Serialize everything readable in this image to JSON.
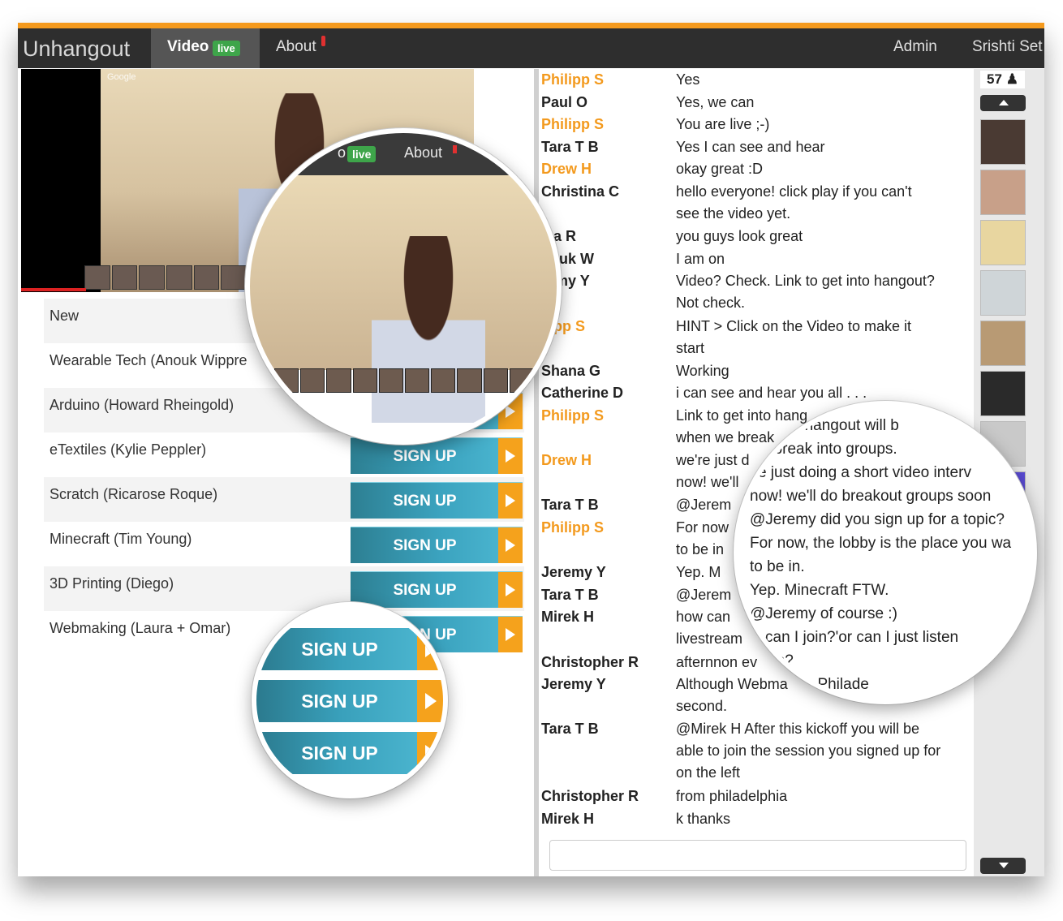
{
  "navbar": {
    "brand": "Unhangout",
    "video_tab": "Video",
    "live_badge": "live",
    "about_tab": "About",
    "admin": "Admin",
    "user": "Srishti Set"
  },
  "video": {
    "watermark": "Google"
  },
  "sessions": [
    {
      "name": "New",
      "has_signup": false
    },
    {
      "name": "Wearable Tech (Anouk Wippre",
      "has_signup": false
    },
    {
      "name": "Arduino (Howard Rheingold)",
      "has_signup": true
    },
    {
      "name": "eTextiles (Kylie Peppler)",
      "has_signup": true
    },
    {
      "name": "Scratch (Ricarose Roque)",
      "has_signup": true
    },
    {
      "name": "Minecraft (Tim Young)",
      "has_signup": true
    },
    {
      "name": "3D Printing (Diego)",
      "has_signup": true
    },
    {
      "name": "Webmaking (Laura + Omar)",
      "has_signup": true
    }
  ],
  "signup_label": "SIGN UP",
  "chat": [
    {
      "name": "Philipp S",
      "highlight": true,
      "lines": [
        "Yes"
      ]
    },
    {
      "name": "Paul O",
      "highlight": false,
      "lines": [
        "Yes, we can"
      ]
    },
    {
      "name": "Philipp S",
      "highlight": true,
      "lines": [
        "You are live ;-)"
      ]
    },
    {
      "name": "Tara T B",
      "highlight": false,
      "lines": [
        "Yes I can see and hear"
      ]
    },
    {
      "name": "Drew H",
      "highlight": true,
      "lines": [
        "okay great :D"
      ]
    },
    {
      "name": "Christina C",
      "highlight": false,
      "lines": [
        "hello everyone! click play if you can't",
        "see the video yet."
      ]
    },
    {
      "name": "lsa R",
      "highlight": false,
      "lines": [
        "you guys look great"
      ]
    },
    {
      "name": "nouk W",
      "highlight": false,
      "lines": [
        "I am on"
      ]
    },
    {
      "name": "remy Y",
      "highlight": false,
      "lines": [
        "Video? Check. Link to get into hangout?",
        "Not check."
      ]
    },
    {
      "name": "ilipp S",
      "highlight": true,
      "lines": [
        "HINT > Click on the Video to make it",
        "start"
      ]
    },
    {
      "name": "Shana G",
      "highlight": false,
      "lines": [
        "Working"
      ]
    },
    {
      "name": "Catherine D",
      "highlight": false,
      "lines": [
        "i can see and hear you all . . ."
      ]
    },
    {
      "name": "Philipp S",
      "highlight": true,
      "lines": [
        "Link to get into hang",
        "when we break"
      ]
    },
    {
      "name": "Drew H",
      "highlight": true,
      "lines": [
        "we're just d",
        "now! we'll"
      ]
    },
    {
      "name": "Tara T B",
      "highlight": false,
      "lines": [
        "@Jerem"
      ]
    },
    {
      "name": "Philipp S",
      "highlight": true,
      "lines": [
        "For now",
        "to be in"
      ]
    },
    {
      "name": "Jeremy Y",
      "highlight": false,
      "lines": [
        "Yep. M"
      ]
    },
    {
      "name": "Tara T B",
      "highlight": false,
      "lines": [
        "@Jerem"
      ]
    },
    {
      "name": "Mirek H",
      "highlight": false,
      "lines": [
        "how can",
        "livestream"
      ]
    },
    {
      "name": "Christopher R",
      "highlight": false,
      "lines": [
        "afternnon ev"
      ]
    },
    {
      "name": "Jeremy Y",
      "highlight": false,
      "lines": [
        "Although Webma",
        "second."
      ]
    },
    {
      "name": "Tara T B",
      "highlight": false,
      "lines": [
        "@Mirek H After this kickoff you will be",
        "able to join the session you signed up for",
        "on the left"
      ]
    },
    {
      "name": "Christopher R",
      "highlight": false,
      "lines": [
        "from philadelphia"
      ]
    },
    {
      "name": "Mirek H",
      "highlight": false,
      "lines": [
        "k thanks"
      ]
    }
  ],
  "users": {
    "count": "57",
    "avatar_colors": [
      "#4a3a33",
      "#c8a089",
      "#e8d6a0",
      "#cfd5d8",
      "#b89a74",
      "#2a2a2a",
      "#c9c9c9",
      "#5a4bd4"
    ]
  },
  "zoom_video": {
    "live_badge": "live",
    "about": "About",
    "partial_tab": "o"
  },
  "zoom_chat": [
    "get into hangout will b",
    "we break into groups.",
    "'re just doing a short video interv",
    "now! we'll do breakout groups soon",
    "@Jeremy did you sign up for a topic?",
    "For now, the lobby is the place you wa",
    "to be in.",
    "Yep. Minecraft FTW.",
    "@Jeremy of course :)",
    "w can I join?'or can I just listen",
    "ream?",
    "everyone Philade"
  ],
  "zoom_signup": [
    "SIGN UP",
    "SIGN UP",
    "SIGN UP"
  ],
  "colors": {
    "accent_orange": "#f39a1e",
    "button_teal": "#3ba3bf",
    "live_green": "#3ea54a"
  }
}
